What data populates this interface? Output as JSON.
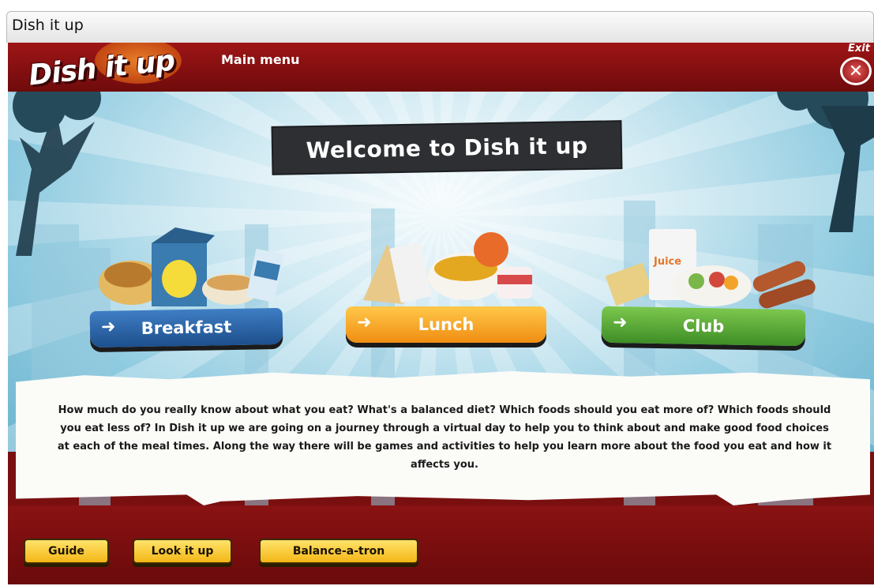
{
  "window": {
    "title": "Dish it up"
  },
  "header": {
    "logo_text": "Dish it up",
    "section_title": "Main menu",
    "exit_label": "Exit",
    "exit_symbol": "✕"
  },
  "welcome": {
    "title": "Welcome to Dish it up"
  },
  "meals": [
    {
      "label": "Breakfast",
      "color": "#1f5fa6"
    },
    {
      "label": "Lunch",
      "color": "#f29a16"
    },
    {
      "label": "Club",
      "color": "#4aa23a"
    }
  ],
  "intro_text": "How much do you really know about what you eat? What's a balanced diet? Which foods should you eat more of? Which foods should you eat less of? In Dish it up we are going on a journey through a virtual day to help you to think about and make good food choices at each of the meal times. Along the way there will be games and activities to help you learn more about the food you eat and how it affects you.",
  "bottom_nav": [
    {
      "label": "Guide"
    },
    {
      "label": "Look it up"
    },
    {
      "label": "Balance-a-tron"
    }
  ],
  "icons": {
    "arrow": "arrow-right-icon",
    "exit": "close-icon"
  },
  "colors": {
    "banner": "#8a1213",
    "button_yellow": "#f3b617",
    "sky": "#8fcbe0"
  }
}
